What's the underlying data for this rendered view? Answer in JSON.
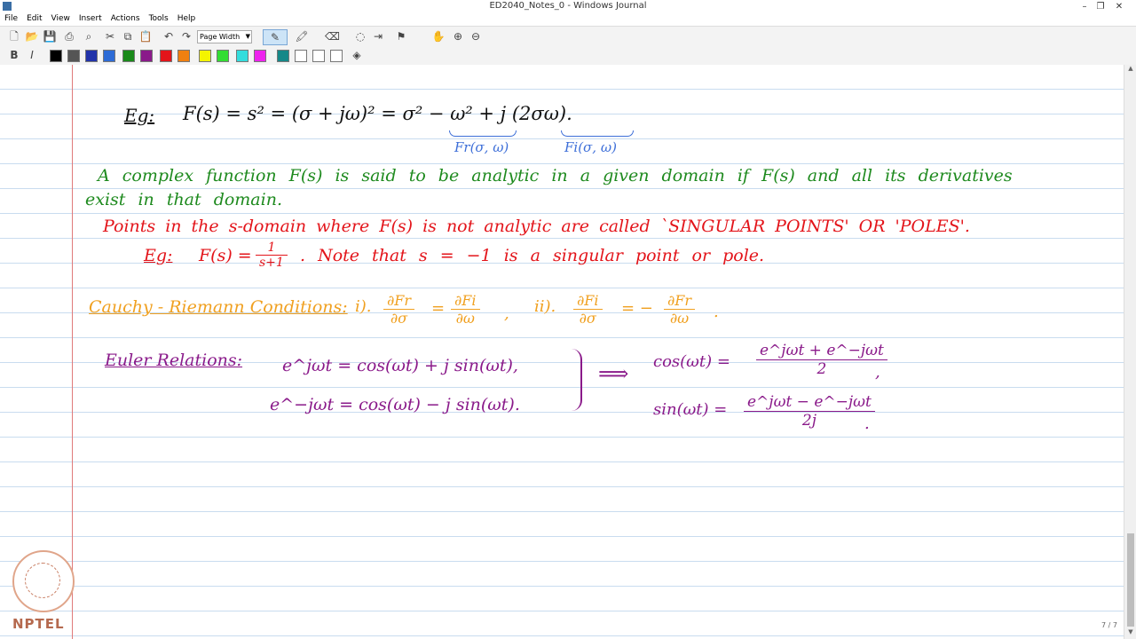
{
  "window": {
    "title": "ED2040_Notes_0 - Windows Journal"
  },
  "menu": [
    "File",
    "Edit",
    "View",
    "Insert",
    "Actions",
    "Tools",
    "Help"
  ],
  "toolbar": {
    "page_width": "Page Width"
  },
  "colors": {
    "black": "#111111",
    "green": "#1e8a1e",
    "red": "#e3141a",
    "orange": "#f0a020",
    "purple": "#8a1a8a",
    "blue": "#3e6fd8"
  },
  "palette": [
    "#000000",
    "#555555",
    "#2233aa",
    "#2d6bd6",
    "#1a8a1a",
    "#8a1a8a",
    "#e3141a",
    "#f08010",
    "#f4f400",
    "#33dd33",
    "#33dddd",
    "#ee22ee",
    "#158888",
    "#ffffff",
    "#ffffff",
    "#ffffff"
  ],
  "notes": {
    "eg1_label": "Eg:",
    "eg1_expr": "F(s) = s² = (σ + jω)² = σ² − ω² + j (2σω).",
    "fr_label": "Fr(σ, ω)",
    "fi_label": "Fi(σ, ω)",
    "analytic_line1": "A complex function F(s) is said to be analytic in a given domain if F(s) and all its derivatives",
    "analytic_line2": "exist in that domain.",
    "poles_line": "Points in the s-domain where F(s) is not analytic are called `SINGULAR POINTS' OR 'POLES'.",
    "eg2_label": "Eg:",
    "eg2_lhs": "F(s) =",
    "eg2_num": "1",
    "eg2_den": "s+1",
    "eg2_rest": ". Note that s = −1 is a singular point or pole.",
    "cr_label": "Cauchy - Riemann Conditions:",
    "cr_i": "i).",
    "cr_n1": "∂Fr",
    "cr_d1": "∂σ",
    "cr_eq1": "=",
    "cr_n2": "∂Fi",
    "cr_d2": "∂ω",
    "cr_sep": ",",
    "cr_ii": "ii).",
    "cr_n3": "∂Fi",
    "cr_d3": "∂σ",
    "cr_eq2": "= −",
    "cr_n4": "∂Fr",
    "cr_d4": "∂ω",
    "cr_end": ".",
    "euler_label": "Euler Relations:",
    "euler1": "e^jωt = cos(ωt) + j sin(ωt),",
    "euler2": "e^−jωt = cos(ωt) − j sin(ωt).",
    "implies": "⟹",
    "cos_lhs": "cos(ωt) =",
    "cos_num": "e^jωt + e^−jωt",
    "cos_den": "2",
    "cos_end": ",",
    "sin_lhs": "sin(ωt) =",
    "sin_num": "e^jωt − e^−jωt",
    "sin_den": "2j",
    "sin_end": "."
  },
  "logo": {
    "text": "NPTEL"
  },
  "status": {
    "page": "7 / 7"
  }
}
